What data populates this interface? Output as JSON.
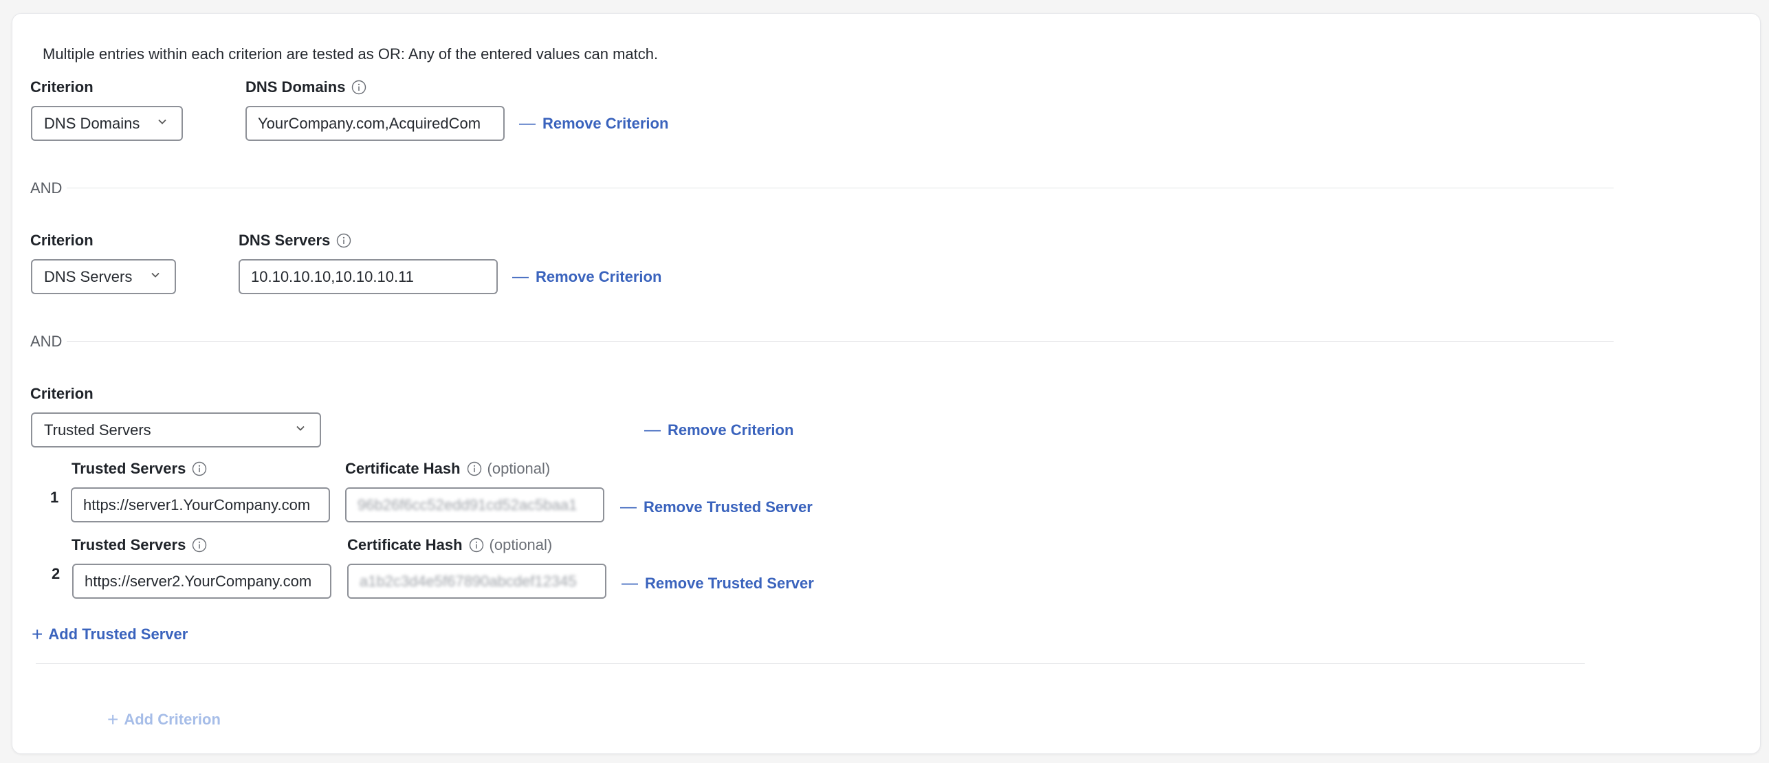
{
  "intro_text": "Multiple entries within each criterion are tested as OR: Any of the entered values can match.",
  "criteria": [
    {
      "criterion_label": "Criterion",
      "selected": "DNS Domains",
      "field_label": "DNS Domains",
      "field_value": "YourCompany.com,AcquiredCom",
      "remove_label": "Remove Criterion"
    },
    {
      "criterion_label": "Criterion",
      "selected": "DNS Servers",
      "field_label": "DNS Servers",
      "field_value": "10.10.10.10,10.10.10.11",
      "remove_label": "Remove Criterion"
    },
    {
      "criterion_label": "Criterion",
      "selected": "Trusted Servers",
      "remove_label": "Remove Criterion",
      "servers": [
        {
          "index": "1",
          "server_label": "Trusted Servers",
          "server_value": "https://server1.YourCompany.com",
          "hash_label": "Certificate Hash",
          "hash_optional": "(optional)",
          "hash_value": "96b26f6cc52edd91cd52ac5baa1",
          "remove_label": "Remove Trusted Server"
        },
        {
          "index": "2",
          "server_label": "Trusted Servers",
          "server_value": "https://server2.YourCompany.com",
          "hash_label": "Certificate Hash",
          "hash_optional": "(optional)",
          "hash_value": "a1b2c3d4e5f67890abcdef12345",
          "remove_label": "Remove Trusted Server"
        }
      ],
      "add_server_label": "Add Trusted Server"
    }
  ],
  "and_label": "AND",
  "add_criterion_label": "Add Criterion",
  "icons": {
    "info": "info-circle-icon",
    "chevron": "chevron-down-icon",
    "minus": "minus-icon",
    "plus": "plus-icon"
  },
  "colors": {
    "link": "#3a63bd",
    "link_disabled": "#a6bde8",
    "border": "#8e9198"
  }
}
